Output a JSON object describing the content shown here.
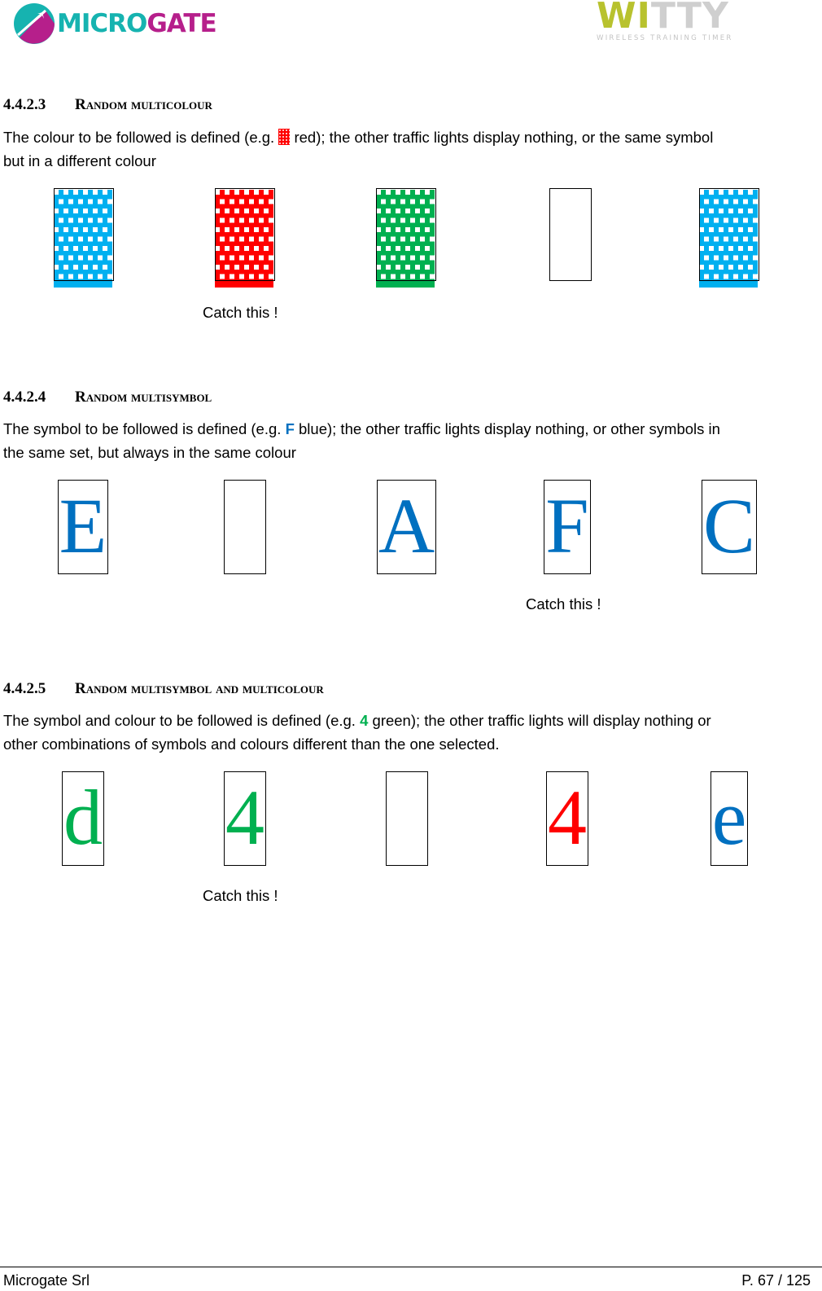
{
  "header": {
    "left_logo": {
      "part1": "MICRO",
      "part2": "GATE",
      "colors": {
        "teal": "#16b3b0",
        "magenta": "#b61f8b"
      }
    },
    "right_logo": {
      "part1": "WI",
      "part2": "TTY",
      "tagline": "WIRELESS TRAINING TIMER",
      "colors": {
        "lime": "#b8c22e",
        "gray": "#cfcfcf"
      }
    }
  },
  "sections": [
    {
      "number": "4.4.2.3",
      "title": "Random multicolour",
      "text_before": "The colour to be followed is defined (e.g. ",
      "example_icon": "red-dot-matrix-swatch",
      "text_after": " red); the other traffic lights display nothing, or the same symbol",
      "text_line2": "but in a different colour",
      "lights": [
        {
          "type": "dot-matrix",
          "color": "#00b0f0"
        },
        {
          "type": "dot-matrix",
          "color": "#ff0000"
        },
        {
          "type": "dot-matrix",
          "color": "#00b050"
        },
        {
          "type": "blank"
        },
        {
          "type": "dot-matrix",
          "color": "#00b0f0"
        }
      ],
      "caption": "Catch this !",
      "caption_index": 1
    },
    {
      "number": "4.4.2.4",
      "title": "Random multisymbol",
      "text_before": "The symbol to be followed is defined (e.g. ",
      "example_symbol": "F",
      "example_color": "#0070c0",
      "text_after": " blue); the other traffic lights display nothing, or other symbols in",
      "text_line2": "the same set, but always in the same colour",
      "lights": [
        {
          "symbol": "E",
          "color": "#0070c0"
        },
        {
          "symbol": "",
          "color": ""
        },
        {
          "symbol": "A",
          "color": "#0070c0"
        },
        {
          "symbol": "F",
          "color": "#0070c0"
        },
        {
          "symbol": "C",
          "color": "#0070c0"
        }
      ],
      "caption": "Catch this !",
      "caption_index": 3
    },
    {
      "number": "4.4.2.5",
      "title": "Random multisymbol and multicolour",
      "text_before": "The symbol and colour to be followed is defined (e.g. ",
      "example_symbol": "4",
      "example_color": "#00b050",
      "text_after": " green); the other traffic lights will display nothing or",
      "text_line2": "other combinations of symbols and colours different than the one selected.",
      "lights": [
        {
          "symbol": "d",
          "color": "#00b050"
        },
        {
          "symbol": "4",
          "color": "#00b050"
        },
        {
          "symbol": "",
          "color": ""
        },
        {
          "symbol": "4",
          "color": "#ff0000"
        },
        {
          "symbol": "e",
          "color": "#0070c0"
        }
      ],
      "caption": "Catch this !",
      "caption_index": 1
    }
  ],
  "footer": {
    "company": "Microgate Srl",
    "page": "P. 67 / 125"
  }
}
